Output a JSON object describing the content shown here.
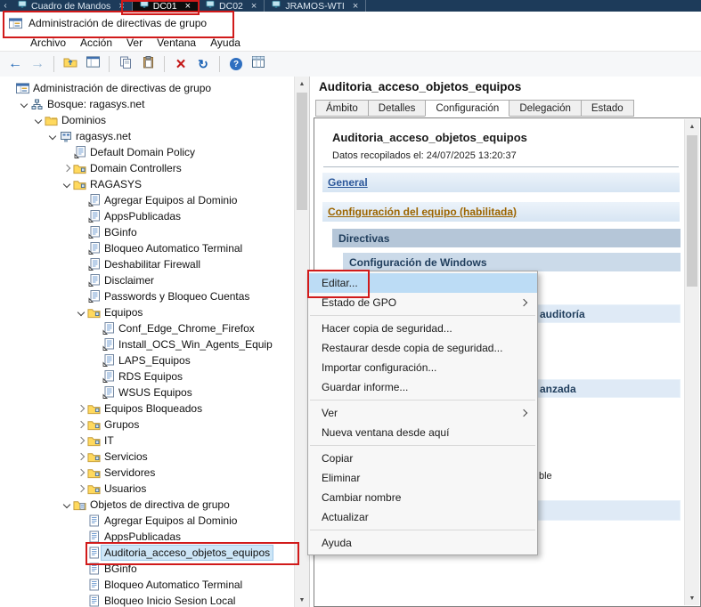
{
  "colors": {
    "annotation_red": "#d11a1a",
    "menu_selection": "#bcdcf5",
    "topbar_bg": "#1d3b5a",
    "active_tab_bg": "#0d0d0d"
  },
  "remote_tabs": {
    "scroll_left_glyph": "‹",
    "close_glyph": "×",
    "tabs": [
      {
        "label": "Cuadro de Mandos",
        "active": false,
        "boxed": false
      },
      {
        "label": "DC01",
        "active": true,
        "boxed": true
      },
      {
        "label": "DC02",
        "active": false,
        "boxed": false
      },
      {
        "label": "JRAMOS-WTI",
        "active": false,
        "boxed": false
      }
    ]
  },
  "window": {
    "title": "Administración de directivas de grupo"
  },
  "menubar": {
    "items": [
      "Archivo",
      "Acción",
      "Ver",
      "Ventana",
      "Ayuda"
    ]
  },
  "toolbar": {
    "buttons": [
      {
        "icon": "back"
      },
      {
        "icon": "forward"
      },
      {
        "sep": true
      },
      {
        "icon": "up-level"
      },
      {
        "icon": "show-tree"
      },
      {
        "sep": true
      },
      {
        "icon": "copy"
      },
      {
        "icon": "paste"
      },
      {
        "sep": true
      },
      {
        "icon": "delete"
      },
      {
        "icon": "refresh"
      },
      {
        "sep": true
      },
      {
        "icon": "help"
      },
      {
        "icon": "list-columns"
      }
    ]
  },
  "tree": {
    "items": [
      {
        "depth": 0,
        "expand": "none",
        "icon": "console",
        "label": "Administración de directivas de grupo"
      },
      {
        "depth": 1,
        "expand": "open",
        "icon": "forest",
        "label": "Bosque: ragasys.net"
      },
      {
        "depth": 2,
        "expand": "open",
        "icon": "folder",
        "label": "Dominios"
      },
      {
        "depth": 3,
        "expand": "open",
        "icon": "domain",
        "label": "ragasys.net"
      },
      {
        "depth": 4,
        "expand": "none",
        "icon": "gpolink",
        "label": "Default Domain Policy"
      },
      {
        "depth": 4,
        "expand": "closed",
        "icon": "oufolder",
        "label": "Domain Controllers"
      },
      {
        "depth": 4,
        "expand": "open",
        "icon": "oufolder",
        "label": "RAGASYS"
      },
      {
        "depth": 5,
        "expand": "none",
        "icon": "gpolink",
        "label": "Agregar Equipos al Dominio"
      },
      {
        "depth": 5,
        "expand": "none",
        "icon": "gpolink",
        "label": "AppsPublicadas"
      },
      {
        "depth": 5,
        "expand": "none",
        "icon": "gpolink",
        "label": "BGinfo"
      },
      {
        "depth": 5,
        "expand": "none",
        "icon": "gpolink",
        "label": "Bloqueo Automatico Terminal"
      },
      {
        "depth": 5,
        "expand": "none",
        "icon": "gpolink",
        "label": "Deshabilitar Firewall"
      },
      {
        "depth": 5,
        "expand": "none",
        "icon": "gpolink",
        "label": "Disclaimer"
      },
      {
        "depth": 5,
        "expand": "none",
        "icon": "gpolink",
        "label": "Passwords y Bloqueo Cuentas"
      },
      {
        "depth": 5,
        "expand": "open",
        "icon": "oufolder",
        "label": "Equipos"
      },
      {
        "depth": 6,
        "expand": "none",
        "icon": "gpolink",
        "label": "Conf_Edge_Chrome_Firefox"
      },
      {
        "depth": 6,
        "expand": "none",
        "icon": "gpolink",
        "label": "Install_OCS_Win_Agents_Equip"
      },
      {
        "depth": 6,
        "expand": "none",
        "icon": "gpolink",
        "label": "LAPS_Equipos"
      },
      {
        "depth": 6,
        "expand": "none",
        "icon": "gpolink",
        "label": "RDS Equipos"
      },
      {
        "depth": 6,
        "expand": "none",
        "icon": "gpolink",
        "label": "WSUS Equipos"
      },
      {
        "depth": 5,
        "expand": "closed",
        "icon": "oufolder",
        "label": "Equipos Bloqueados"
      },
      {
        "depth": 5,
        "expand": "closed",
        "icon": "oufolder",
        "label": "Grupos"
      },
      {
        "depth": 5,
        "expand": "closed",
        "icon": "oufolder",
        "label": "IT"
      },
      {
        "depth": 5,
        "expand": "closed",
        "icon": "oufolder",
        "label": "Servicios"
      },
      {
        "depth": 5,
        "expand": "closed",
        "icon": "oufolder",
        "label": "Servidores"
      },
      {
        "depth": 5,
        "expand": "closed",
        "icon": "oufolder",
        "label": "Usuarios"
      },
      {
        "depth": 4,
        "expand": "open",
        "icon": "gpofolder",
        "label": "Objetos de directiva de grupo"
      },
      {
        "depth": 5,
        "expand": "none",
        "icon": "gpo",
        "label": "Agregar Equipos al Dominio"
      },
      {
        "depth": 5,
        "expand": "none",
        "icon": "gpo",
        "label": "AppsPublicadas"
      },
      {
        "depth": 5,
        "expand": "none",
        "icon": "gpo",
        "label": "Auditoria_acceso_objetos_equipos",
        "selected": true,
        "boxed": true
      },
      {
        "depth": 5,
        "expand": "none",
        "icon": "gpo",
        "label": "BGinfo"
      },
      {
        "depth": 5,
        "expand": "none",
        "icon": "gpo",
        "label": "Bloqueo Automatico Terminal"
      },
      {
        "depth": 5,
        "expand": "none",
        "icon": "gpo",
        "label": "Bloqueo Inicio Sesion Local"
      }
    ]
  },
  "details": {
    "title": "Auditoria_acceso_objetos_equipos",
    "tabs": [
      {
        "label": "Ámbito",
        "active": false
      },
      {
        "label": "Detalles",
        "active": false
      },
      {
        "label": "Configuración",
        "active": true
      },
      {
        "label": "Delegación",
        "active": false
      },
      {
        "label": "Estado",
        "active": false
      }
    ],
    "report": {
      "title": "Auditoria_acceso_objetos_equipos",
      "collected": "Datos recopilados el: 24/07/2025 13:20:37",
      "sections": [
        {
          "id": "general",
          "text": "General",
          "kind": "section-link"
        },
        {
          "id": "equipo",
          "text": "Configuración del equipo (habilitada)",
          "kind": "section-link-amber"
        },
        {
          "id": "directivas",
          "text": "Directivas",
          "kind": "subsection"
        },
        {
          "id": "winconf",
          "text": "Configuración de Windows",
          "kind": "subsubsection"
        },
        {
          "id": "audit1",
          "text": "auditoría",
          "kind": "fragment-bar"
        },
        {
          "id": "audit2",
          "text": "anzada",
          "kind": "fragment-bar"
        },
        {
          "id": "txt1",
          "text": "ble",
          "kind": "fragment-text"
        },
        {
          "id": "bar-empty",
          "text": "",
          "kind": "fragment-bar"
        }
      ]
    }
  },
  "context_menu": {
    "items": [
      {
        "label": "Editar...",
        "selected": true,
        "boxed": true
      },
      {
        "label": "Estado de GPO",
        "submenu": true
      },
      {
        "separator": true
      },
      {
        "label": "Hacer copia de seguridad..."
      },
      {
        "label": "Restaurar desde copia de seguridad..."
      },
      {
        "label": "Importar configuración..."
      },
      {
        "label": "Guardar informe..."
      },
      {
        "separator": true
      },
      {
        "label": "Ver",
        "submenu": true
      },
      {
        "label": "Nueva ventana desde aquí"
      },
      {
        "separator": true
      },
      {
        "label": "Copiar"
      },
      {
        "label": "Eliminar"
      },
      {
        "label": "Cambiar nombre"
      },
      {
        "label": "Actualizar"
      },
      {
        "separator": true
      },
      {
        "label": "Ayuda"
      }
    ]
  },
  "annotations": [
    {
      "id": "box-dc01",
      "label": "DC01 tab highlight"
    },
    {
      "id": "box-title",
      "label": "window title highlight"
    },
    {
      "id": "box-editar",
      "label": "Editar menu item highlight"
    },
    {
      "id": "box-gpo",
      "label": "Auditoria GPO tree item highlight"
    }
  ]
}
